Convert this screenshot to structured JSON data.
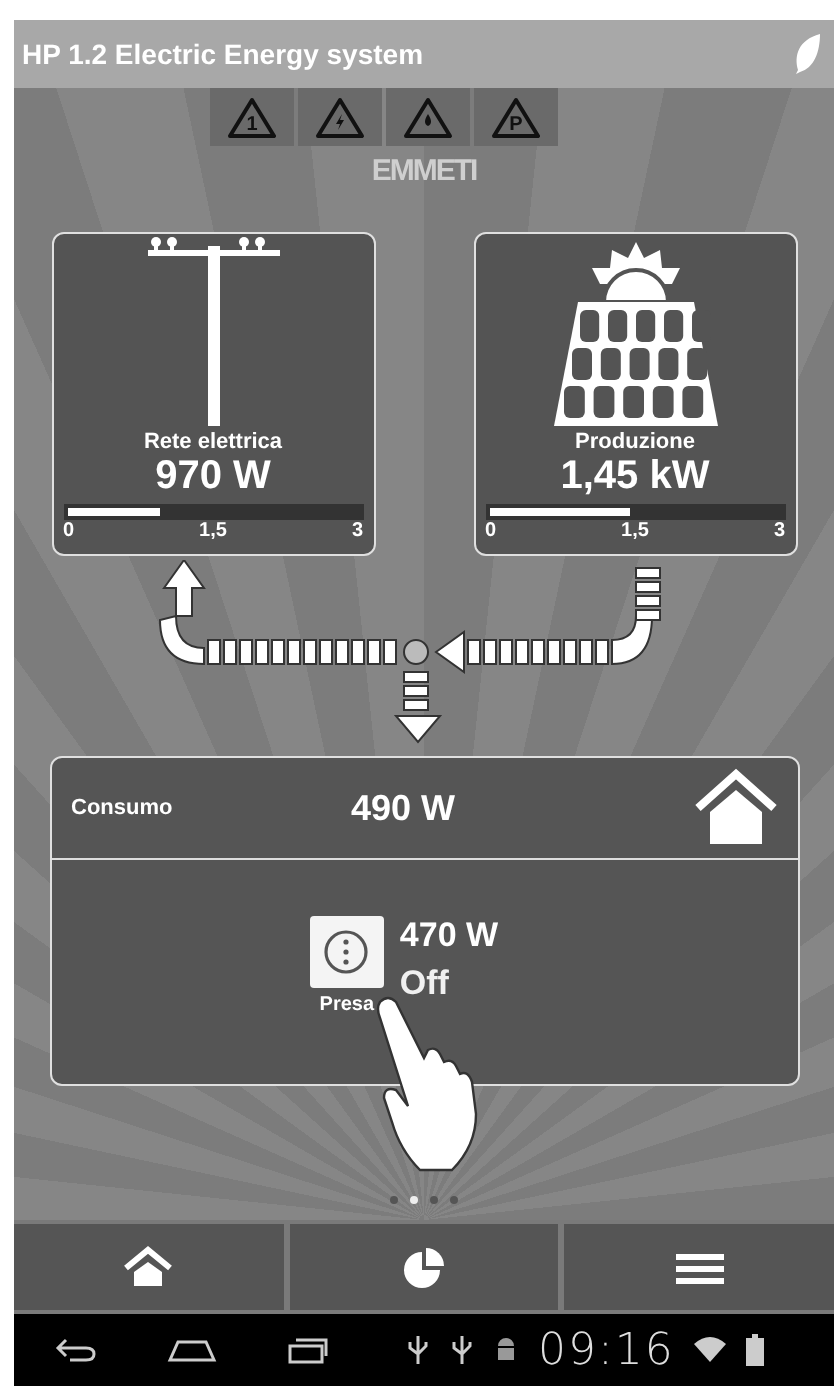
{
  "window": {
    "title": "HP 1.2 Electric Energy system"
  },
  "alerts": [
    {
      "kind": "text",
      "label": "1"
    },
    {
      "kind": "bolt"
    },
    {
      "kind": "drop"
    },
    {
      "kind": "text",
      "label": "P"
    }
  ],
  "logo": "EMMETI",
  "sources": [
    {
      "kind": "grid",
      "label": "Rete elettrica",
      "value": "970 W",
      "level": 0.32,
      "ticks": [
        "0",
        "1,5",
        "3"
      ]
    },
    {
      "kind": "solar",
      "label": "Produzione",
      "value": "1,45 kW",
      "level": 0.48,
      "ticks": [
        "0",
        "1,5",
        "3"
      ]
    }
  ],
  "consumption": {
    "label": "Consumo",
    "value": "490 W",
    "device": {
      "label": "Presa",
      "power": "470 W",
      "state": "Off"
    }
  },
  "pages": [
    {
      "selected": false
    },
    {
      "selected": true
    },
    {
      "selected": false
    },
    {
      "selected": false
    }
  ],
  "nav": [
    {
      "kind": "home"
    },
    {
      "kind": "chart"
    },
    {
      "kind": "menu"
    }
  ],
  "status_bar": {
    "time": "09:16"
  }
}
